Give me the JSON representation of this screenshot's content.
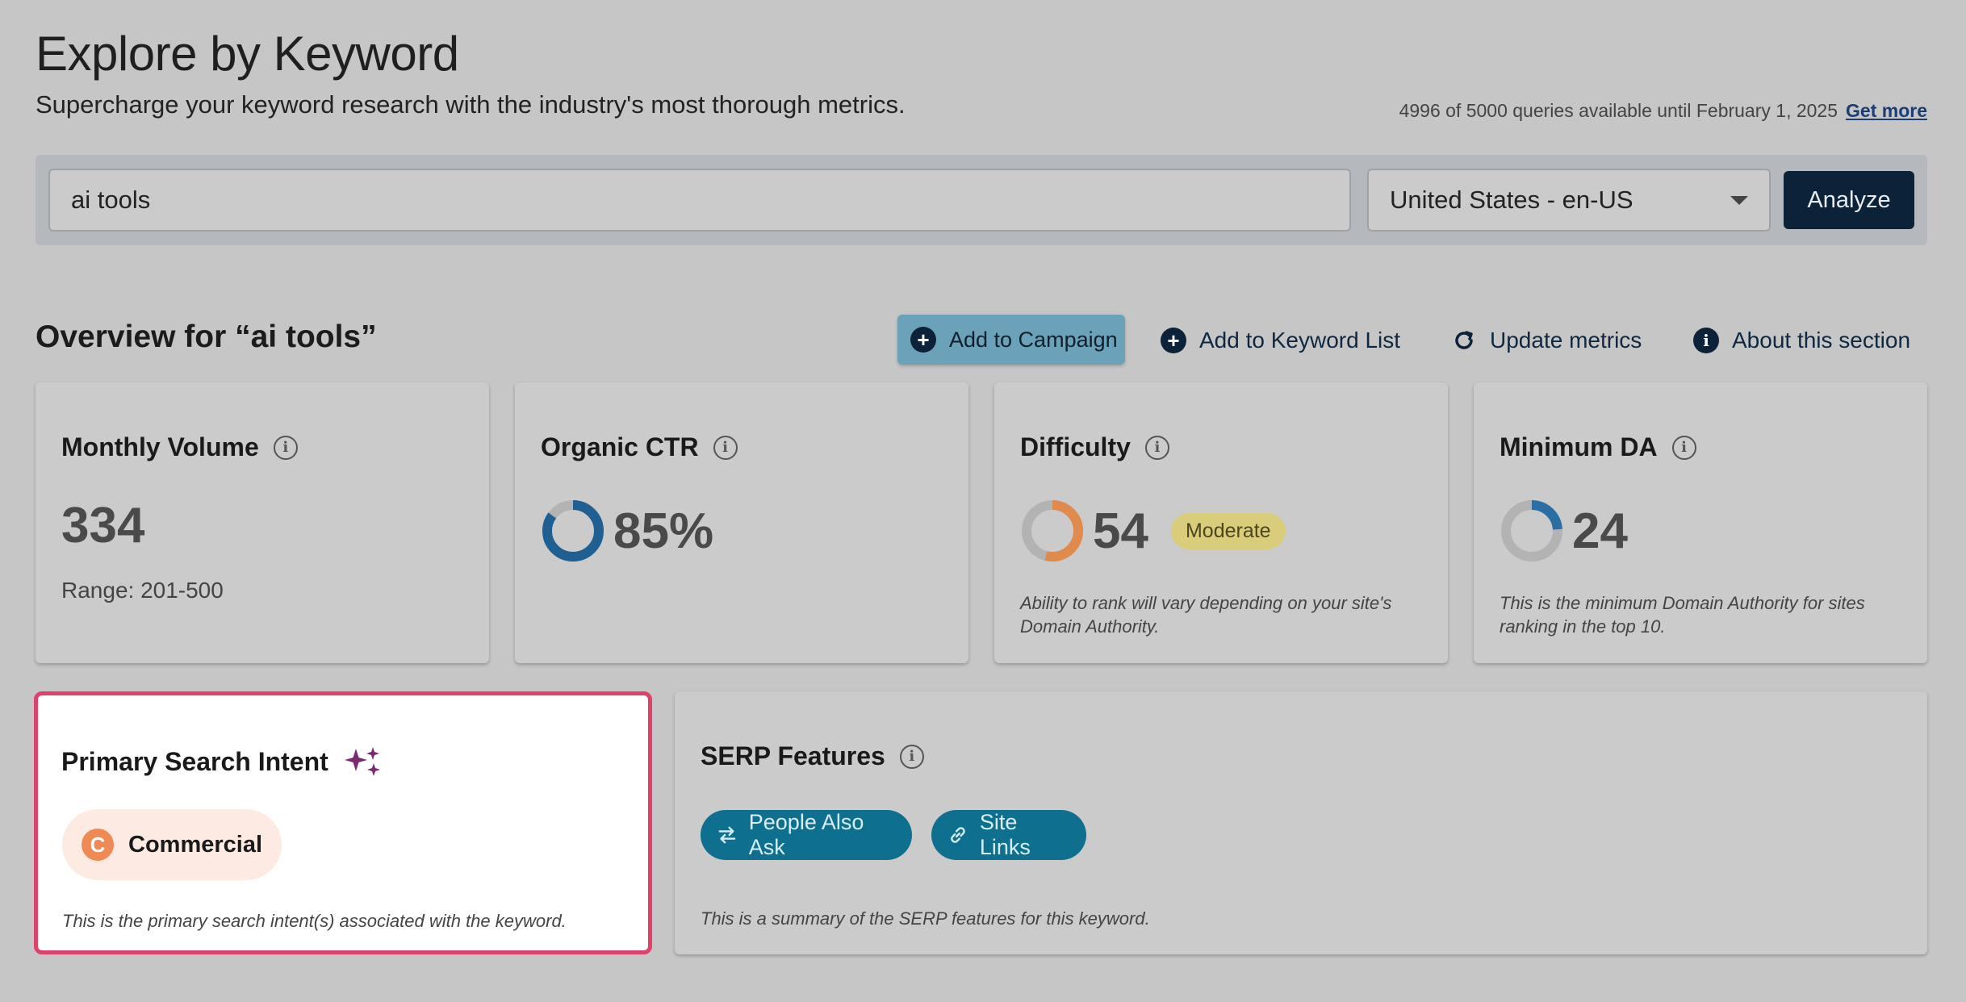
{
  "header": {
    "title": "Explore by Keyword",
    "subtitle": "Supercharge your keyword research with the industry's most thorough metrics.",
    "quota_text": "4996 of 5000 queries available until February 1, 2025",
    "get_more_label": "Get more"
  },
  "search": {
    "keyword_value": "ai tools",
    "locale_value": "United States - en-US",
    "analyze_label": "Analyze"
  },
  "overview": {
    "title": "Overview for “ai tools”",
    "actions": {
      "add_campaign": "Add to Campaign",
      "add_keyword_list": "Add to Keyword List",
      "update_metrics": "Update metrics",
      "about_section": "About this section"
    }
  },
  "metrics": {
    "monthly_volume": {
      "label": "Monthly Volume",
      "value": "334",
      "range": "Range: 201-500"
    },
    "organic_ctr": {
      "label": "Organic CTR",
      "value": "85%",
      "fraction": 0.85
    },
    "difficulty": {
      "label": "Difficulty",
      "value": "54",
      "fraction": 0.54,
      "badge": "Moderate",
      "note": "Ability to rank will vary depending on your site's Domain Authority."
    },
    "minimum_da": {
      "label": "Minimum DA",
      "value": "24",
      "fraction": 0.24,
      "note": "This is the minimum Domain Authority for sites ranking in the top 10."
    }
  },
  "intent": {
    "title": "Primary Search Intent",
    "pill_label": "Commercial",
    "pill_letter": "C",
    "note": "This is the primary search intent(s) associated with the keyword."
  },
  "serp": {
    "title": "SERP Features",
    "features": [
      "People Also Ask",
      "Site Links"
    ],
    "note": "This is a summary of the SERP features for this keyword."
  },
  "colors": {
    "navy": "#0c2238",
    "ctr_ring": "#1f5f92",
    "difficulty_ring": "#e08a4e",
    "da_ring": "#2b6ea5",
    "intent_border": "#e0416b",
    "serp_pill": "#0e6f8e"
  }
}
